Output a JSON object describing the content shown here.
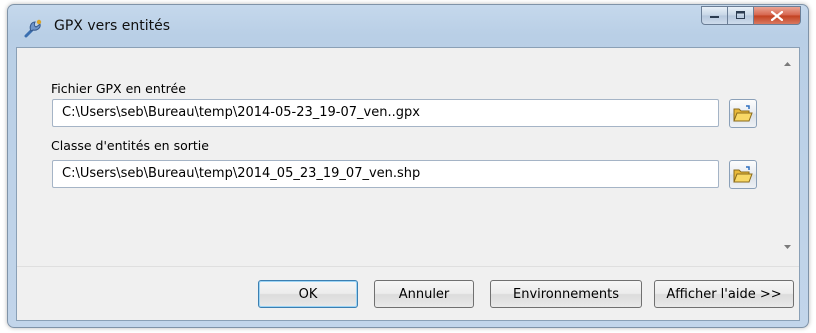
{
  "window": {
    "title": "GPX vers entités"
  },
  "titlebar": {
    "buttons": [
      "minimize",
      "maximize",
      "close"
    ]
  },
  "form": {
    "input_label": "Fichier GPX en entrée",
    "input_value": "C:\\Users\\seb\\Bureau\\temp\\2014-05-23_19-07_ven..gpx",
    "output_label": "Classe d'entités en sortie",
    "output_value": "C:\\Users\\seb\\Bureau\\temp\\2014_05_23_19_07_ven.shp"
  },
  "icons": {
    "app": "toolbox-tool-icon",
    "browse": "open-folder-icon"
  },
  "footer": {
    "ok": "OK",
    "cancel": "Annuler",
    "environments": "Environnements",
    "help": "Afficher l'aide >>"
  },
  "colors": {
    "frame": "#bcd1e8",
    "client": "#f0f0f0",
    "close_button": "#c9452a",
    "default_button_border": "#3c7fb1"
  }
}
